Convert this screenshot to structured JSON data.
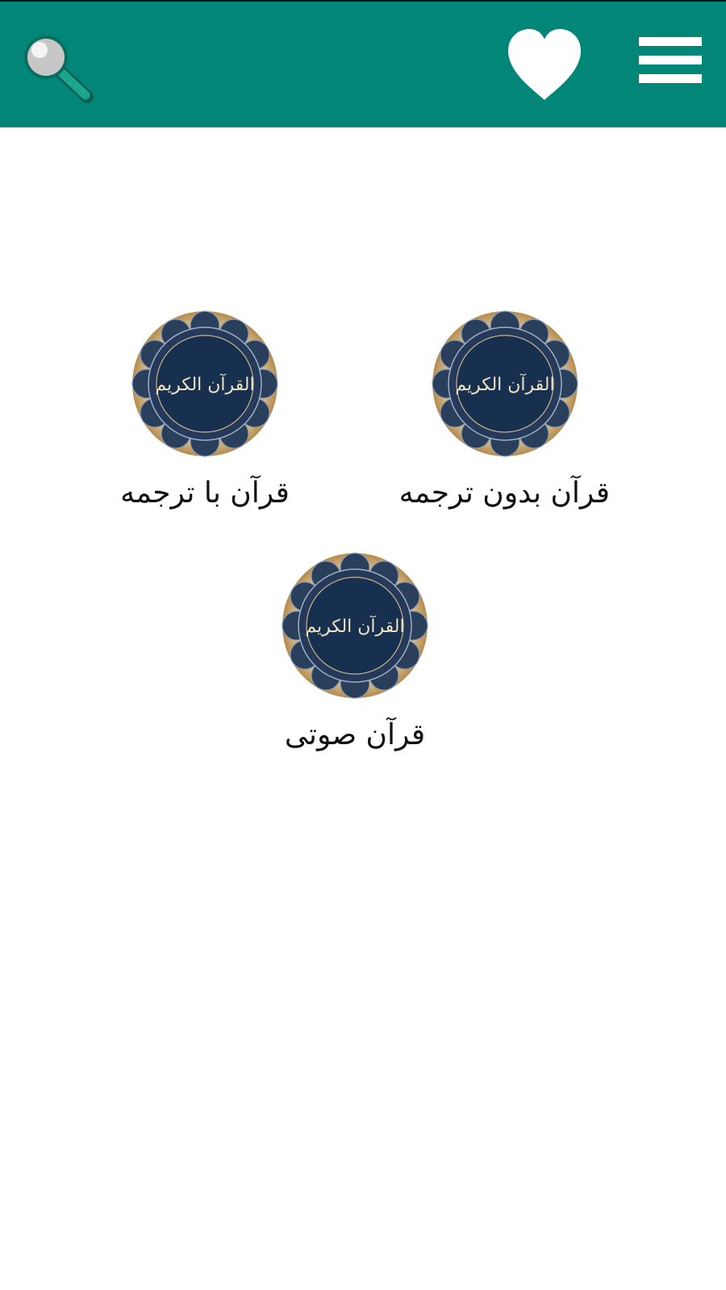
{
  "colors": {
    "appbar": "#028677",
    "accent_dark": "#0a6a5e",
    "icon": "#ffffff",
    "emblem_navy": "#17304f",
    "emblem_gold": "#c9a66b"
  },
  "appbar": {
    "search_icon": "magnifier-icon",
    "favorite_icon": "heart-icon",
    "menu_icon": "hamburger-icon"
  },
  "tiles": [
    {
      "label": "قرآن بدون ترجمه",
      "icon": "quran-emblem-icon",
      "emblem_text": "القرآن الكريم"
    },
    {
      "label": "قرآن با ترجمه",
      "icon": "quran-emblem-icon",
      "emblem_text": "القرآن الكريم"
    },
    {
      "label": "قرآن صوتی",
      "icon": "quran-emblem-icon",
      "emblem_text": "القرآن الكريم"
    }
  ]
}
